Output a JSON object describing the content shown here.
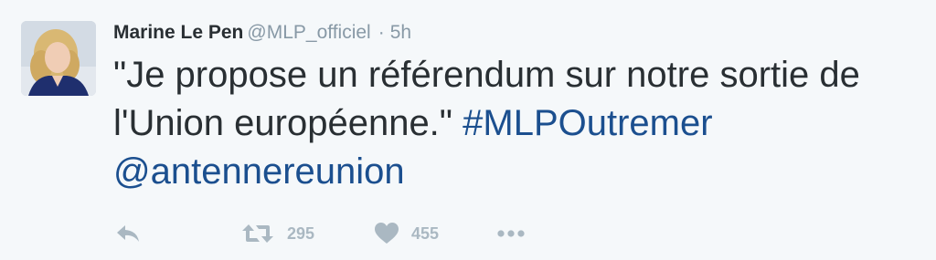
{
  "tweet": {
    "author_name": "Marine Le Pen",
    "author_handle": "@MLP_officiel",
    "separator": "·",
    "timestamp": "5h",
    "text_plain": "\"Je propose un référendum sur notre sortie de l'Union européenne.\"",
    "hashtag": "#MLPOutremer",
    "mention": "@antennereunion"
  },
  "actions": {
    "reply_icon": "reply-icon",
    "retweet_icon": "retweet-icon",
    "retweet_count": "295",
    "like_icon": "heart-icon",
    "like_count": "455",
    "more_icon": "more-dots-icon"
  },
  "colors": {
    "background": "#f5f8fa",
    "text": "#292f33",
    "muted": "#8899a6",
    "link": "#1b4f8f",
    "icon": "#aab8c2"
  }
}
